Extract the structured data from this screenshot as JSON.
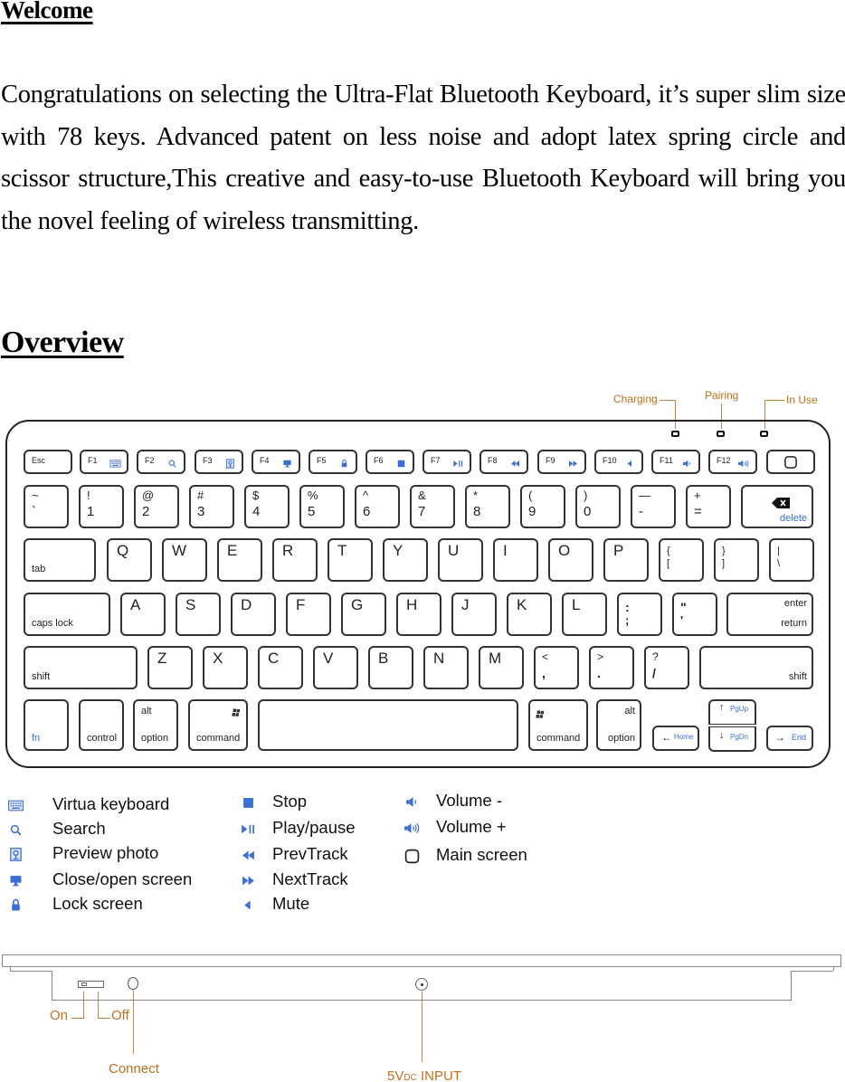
{
  "welcome": {
    "title": "Welcome ",
    "paragraph": "Congratulations on selecting the Ultra-Flat Bluetooth Keyboard, it’s super slim size with 78 keys. Advanced patent on less noise and adopt latex spring circle and scissor structure,This creative and easy-to-use Bluetooth Keyboard will bring you the novel feeling of wireless transmitting."
  },
  "overview": {
    "title": "Overview"
  },
  "indicators": {
    "charging": "Charging",
    "pairing": "Pairing",
    "in_use": "In Use"
  },
  "keyboard": {
    "function_row": [
      {
        "label": "Esc",
        "icon": ""
      },
      {
        "label": "F1",
        "icon": "keyboard-icon"
      },
      {
        "label": "F2",
        "icon": "search-icon"
      },
      {
        "label": "F3",
        "icon": "preview-photo-icon"
      },
      {
        "label": "F4",
        "icon": "screen-icon"
      },
      {
        "label": "F5",
        "icon": "lock-icon"
      },
      {
        "label": "F6",
        "icon": "stop-icon"
      },
      {
        "label": "F7",
        "icon": "play-pause-icon"
      },
      {
        "label": "F8",
        "icon": "prev-track-icon"
      },
      {
        "label": "F9",
        "icon": "next-track-icon"
      },
      {
        "label": "F10",
        "icon": "mute-icon"
      },
      {
        "label": "F11",
        "icon": "volume-down-icon"
      },
      {
        "label": "F12",
        "icon": "volume-up-icon"
      },
      {
        "label": "",
        "icon": "main-screen-icon"
      }
    ],
    "number_row": [
      {
        "top": "~",
        "bottom": "`"
      },
      {
        "top": "!",
        "bottom": "1"
      },
      {
        "top": "@",
        "bottom": "2"
      },
      {
        "top": "#",
        "bottom": "3"
      },
      {
        "top": "$",
        "bottom": "4"
      },
      {
        "top": "%",
        "bottom": "5"
      },
      {
        "top": "^",
        "bottom": "6"
      },
      {
        "top": "&",
        "bottom": "7"
      },
      {
        "top": "*",
        "bottom": "8"
      },
      {
        "top": "(",
        "bottom": "9"
      },
      {
        "top": ")",
        "bottom": "0"
      },
      {
        "top": "—",
        "bottom": "-"
      },
      {
        "top": "+",
        "bottom": "="
      }
    ],
    "delete_label": "delete",
    "tab_label": "tab",
    "qwerty_row": [
      "Q",
      "W",
      "E",
      "R",
      "T",
      "Y",
      "U",
      "I",
      "O",
      "P"
    ],
    "bracket_keys": [
      {
        "top": "{",
        "bottom": "["
      },
      {
        "top": "}",
        "bottom": "]"
      },
      {
        "top": "|",
        "bottom": "\\"
      }
    ],
    "caps_label": "caps lock",
    "home_row": [
      "A",
      "S",
      "D",
      "F",
      "G",
      "H",
      "J",
      "K",
      "L"
    ],
    "home_punct": [
      {
        "top": ":",
        "bottom": ";"
      },
      {
        "top": "\"",
        "bottom": "'"
      }
    ],
    "enter_label": "enter",
    "return_label": "return",
    "shift_label": "shift",
    "bottom_row": [
      "Z",
      "X",
      "C",
      "V",
      "B",
      "N",
      "M"
    ],
    "bottom_punct": [
      {
        "top": "<",
        "bottom": ","
      },
      {
        "top": ">",
        "bottom": "."
      },
      {
        "top": "?",
        "bottom": "/"
      }
    ],
    "fn_label": "fn",
    "control_label": "control",
    "alt_label": "alt",
    "option_label": "option",
    "command_label": "command",
    "home_key": "Home",
    "end_key": "End",
    "pgup_key": "PgUp",
    "pgdn_key": "PgDn"
  },
  "legend": {
    "col1": [
      {
        "icon": "keyboard-icon",
        "label": "Virtua keyboard"
      },
      {
        "icon": "search-icon",
        "label": "Search"
      },
      {
        "icon": "preview-photo-icon",
        "label": "Preview photo"
      },
      {
        "icon": "screen-icon",
        "label": "Close/open screen"
      },
      {
        "icon": "lock-icon",
        "label": "Lock screen"
      }
    ],
    "col2": [
      {
        "icon": "stop-icon",
        "label": "Stop"
      },
      {
        "icon": "play-pause-icon",
        "label": "Play/pause"
      },
      {
        "icon": "prev-track-icon",
        "label": "PrevTrack"
      },
      {
        "icon": "next-track-icon",
        "label": "NextTrack"
      },
      {
        "icon": "mute-icon",
        "label": "Mute"
      }
    ],
    "col3": [
      {
        "icon": "volume-down-icon",
        "label": "Volume -"
      },
      {
        "icon": "volume-up-icon",
        "label": "Volume +"
      },
      {
        "icon": "main-screen-icon",
        "label": "Main screen"
      }
    ]
  },
  "side_view": {
    "on": "On",
    "off": "Off",
    "connect": "Connect",
    "power_input": "5VDC INPUT",
    "power_input_main": "5V",
    "power_input_sub": "DC",
    "power_input_rest": " INPUT"
  },
  "colors": {
    "accent_blue": "#3c6fd6",
    "callout_orange": "#c0701c"
  }
}
